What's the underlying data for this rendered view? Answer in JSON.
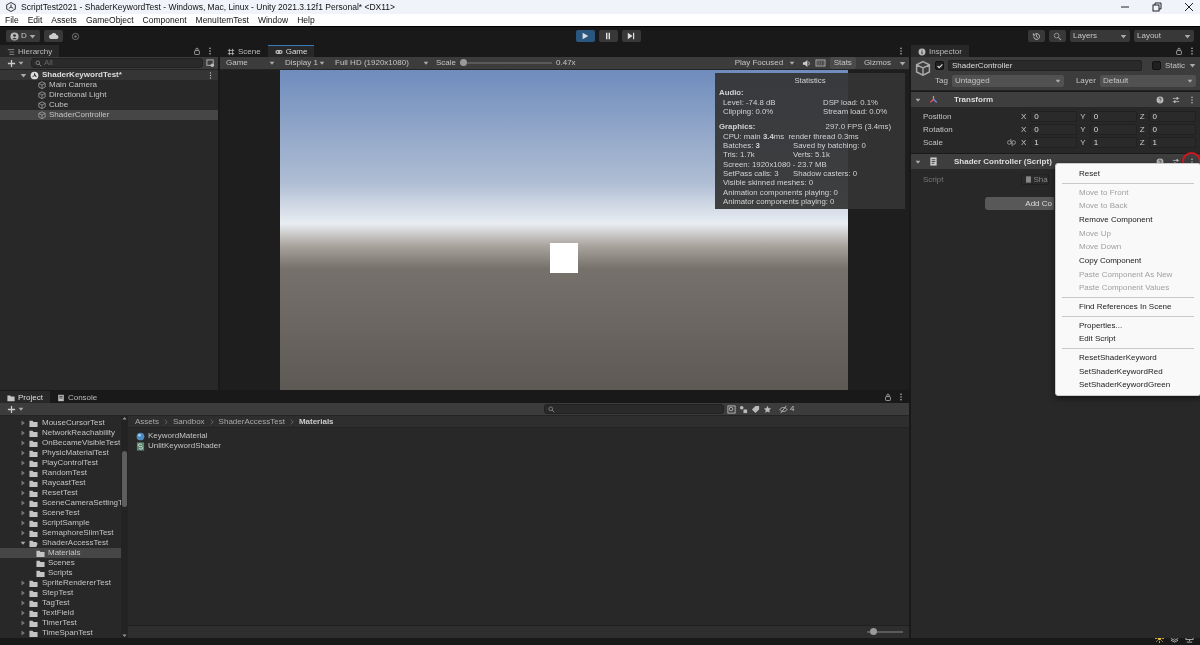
{
  "window": {
    "title": "ScriptTest2021 - ShaderKeywordTest - Windows, Mac, Linux - Unity 2021.3.12f1 Personal* <DX11>"
  },
  "menu_bar": [
    "File",
    "Edit",
    "Assets",
    "GameObject",
    "Component",
    "MenuItemTest",
    "Window",
    "Help"
  ],
  "toolbar": {
    "account": "D",
    "play_buttons": [
      {
        "kind": "play",
        "selected": true
      },
      {
        "kind": "pause",
        "selected": false
      },
      {
        "kind": "step",
        "selected": false
      }
    ],
    "layers": "Layers",
    "layout": "Layout"
  },
  "hierarchy": {
    "title": "Hierarchy",
    "search": {
      "placeholder": "All"
    },
    "scene": {
      "name": "ShaderKeywordTest*",
      "expanded": true,
      "children": [
        {
          "name": "Main Camera",
          "selected": false
        },
        {
          "name": "Directional Light",
          "selected": false
        },
        {
          "name": "Cube",
          "selected": false
        },
        {
          "name": "ShaderController",
          "selected": true
        }
      ]
    }
  },
  "game": {
    "tabs": [
      {
        "label": "Scene",
        "kind": "scene",
        "selected": false
      },
      {
        "label": "Game",
        "kind": "game",
        "selected": true
      }
    ],
    "display_mode": "Game",
    "display": "Display 1",
    "resolution": "Full HD (1920x1080)",
    "scale_label": "Scale",
    "scale_slider": {
      "level": 0.0
    },
    "scale_value": "0.47x",
    "play_mode": "Play Focused",
    "stats_button": {
      "label": "Stats",
      "selected": true
    },
    "gizmos": "Gizmos",
    "statistics": {
      "title": "Statistics",
      "sections": [
        {
          "heading": "Audio:",
          "rows": [
            {
              "left": "Level: -74.8 dB",
              "right": "DSP load: 0.1%"
            },
            {
              "left": "Clipping: 0.0%",
              "right": "Stream load: 0.0%"
            }
          ]
        },
        {
          "heading": "Graphics:",
          "heading_right": "297.0 FPS (3.4ms)",
          "rows": [
            {
              "left": "CPU: main **3.4**ms  render thread 0.3ms"
            },
            {
              "left": "Batches: **3**",
              "right": "Saved by batching: 0"
            },
            {
              "left": "Tris: 1.7k",
              "right": "Verts: 5.1k"
            },
            {
              "left": "Screen: 1920x1080 - 23.7 MB"
            },
            {
              "left": "SetPass calls: 3",
              "right": "Shadow casters: 0"
            },
            {
              "left": "Visible skinned meshes: 0"
            },
            {
              "left": "Animation components playing: 0"
            },
            {
              "left": "Animator components playing: 0"
            }
          ]
        }
      ]
    }
  },
  "inspector": {
    "title": "Inspector",
    "object": {
      "active": true,
      "name": "ShaderController",
      "static": false,
      "static_label": "Static",
      "tag_label": "Tag",
      "tag": "Untagged",
      "layer_label": "Layer",
      "layer": "Default"
    },
    "components": [
      {
        "kind": "transform",
        "title": "Transform",
        "expanded": true,
        "rows": [
          {
            "label": "Position",
            "values": [
              {
                "axis": "X",
                "value": "0"
              },
              {
                "axis": "Y",
                "value": "0"
              },
              {
                "axis": "Z",
                "value": "0"
              }
            ]
          },
          {
            "label": "Rotation",
            "values": [
              {
                "axis": "X",
                "value": "0"
              },
              {
                "axis": "Y",
                "value": "0"
              },
              {
                "axis": "Z",
                "value": "0"
              }
            ]
          },
          {
            "label": "Scale",
            "linked": false,
            "values": [
              {
                "axis": "X",
                "value": "1"
              },
              {
                "axis": "Y",
                "value": "1"
              },
              {
                "axis": "Z",
                "value": "1"
              }
            ]
          }
        ]
      },
      {
        "kind": "script",
        "title": "Shader Controller (Script)",
        "expanded": true,
        "field_label": "Script",
        "field_value": "Sha"
      }
    ],
    "add_component": "Add Co",
    "context_menu": [
      {
        "kind": "item",
        "label": "Reset",
        "disabled": false
      },
      {
        "kind": "separator"
      },
      {
        "kind": "item",
        "label": "Move to Front",
        "disabled": true
      },
      {
        "kind": "item",
        "label": "Move to Back",
        "disabled": true
      },
      {
        "kind": "item",
        "label": "Remove Component",
        "disabled": false
      },
      {
        "kind": "item",
        "label": "Move Up",
        "disabled": true
      },
      {
        "kind": "item",
        "label": "Move Down",
        "disabled": true
      },
      {
        "kind": "item",
        "label": "Copy Component",
        "disabled": false
      },
      {
        "kind": "item",
        "label": "Paste Component As New",
        "disabled": true
      },
      {
        "kind": "item",
        "label": "Paste Component Values",
        "disabled": true
      },
      {
        "kind": "separator"
      },
      {
        "kind": "item",
        "label": "Find References In Scene",
        "disabled": false
      },
      {
        "kind": "separator"
      },
      {
        "kind": "item",
        "label": "Properties...",
        "disabled": false
      },
      {
        "kind": "item",
        "label": "Edit Script",
        "disabled": false
      },
      {
        "kind": "separator"
      },
      {
        "kind": "item",
        "label": "ResetShaderKeyword",
        "disabled": false
      },
      {
        "kind": "item",
        "label": "SetShaderKeywordRed",
        "disabled": false
      },
      {
        "kind": "item",
        "label": "SetShaderKeywordGreen",
        "disabled": false
      }
    ]
  },
  "project": {
    "tabs": [
      {
        "label": "Project",
        "kind": "project",
        "selected": true
      },
      {
        "label": "Console",
        "kind": "console",
        "selected": false
      }
    ],
    "hidden_count": "4",
    "folders": [
      {
        "name": "MouseCursorTest",
        "expanded": false
      },
      {
        "name": "NetworkReachability",
        "expanded": false
      },
      {
        "name": "OnBecameVisibleTest",
        "expanded": false
      },
      {
        "name": "PhysicMaterialTest",
        "expanded": false
      },
      {
        "name": "PlayControlTest",
        "expanded": false
      },
      {
        "name": "RandomTest",
        "expanded": false
      },
      {
        "name": "RaycastTest",
        "expanded": false
      },
      {
        "name": "ResetTest",
        "expanded": false
      },
      {
        "name": "SceneCameraSettingT",
        "expanded": false
      },
      {
        "name": "SceneTest",
        "expanded": false
      },
      {
        "name": "ScriptSample",
        "expanded": false
      },
      {
        "name": "SemaphoreSlimTest",
        "expanded": false
      },
      {
        "name": "ShaderAccessTest",
        "expanded": true,
        "children": [
          {
            "name": "Materials",
            "selected": true
          },
          {
            "name": "Scenes",
            "selected": false
          },
          {
            "name": "Scripts",
            "selected": false
          }
        ]
      },
      {
        "name": "SpriteRendererTest",
        "expanded": false
      },
      {
        "name": "StepTest",
        "expanded": false
      },
      {
        "name": "TagTest",
        "expanded": false
      },
      {
        "name": "TextField",
        "expanded": false
      },
      {
        "name": "TimerTest",
        "expanded": false
      },
      {
        "name": "TimeSpanTest",
        "expanded": false
      }
    ],
    "breadcrumb": [
      "Assets",
      "Sandbox",
      "ShaderAccessTest",
      "Materials"
    ],
    "files": [
      {
        "name": "KeywordMaterial",
        "kind": "material"
      },
      {
        "name": "UnlitKeywordShader",
        "kind": "shader"
      }
    ],
    "zoom_slider": {
      "level": 0.1
    }
  }
}
